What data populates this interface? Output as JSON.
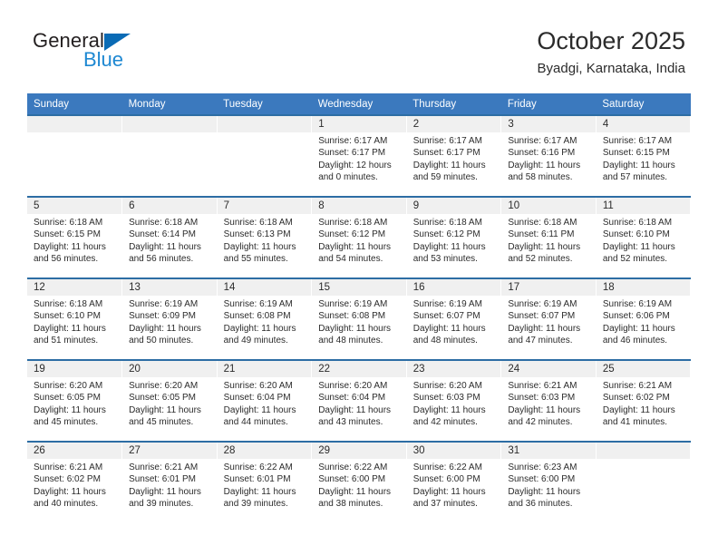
{
  "brand": {
    "name_top": "General",
    "name_bottom": "Blue",
    "triangle_icon": "triangle-icon",
    "accent_blue": "#1e88d2",
    "dark_blue": "#0a6bb5"
  },
  "header": {
    "title": "October 2025",
    "subtitle": "Byadgi, Karnataka, India"
  },
  "theme": {
    "header_row_bg": "#3b79be",
    "row_divider": "#2d6da4",
    "daynum_band_bg": "#f0f0f0",
    "text": "#2b2b2b"
  },
  "weekdays": [
    "Sunday",
    "Monday",
    "Tuesday",
    "Wednesday",
    "Thursday",
    "Friday",
    "Saturday"
  ],
  "weeks": [
    [
      {
        "day": "",
        "sunrise": "",
        "sunset": "",
        "daylight1": "",
        "daylight2": "",
        "empty": true
      },
      {
        "day": "",
        "sunrise": "",
        "sunset": "",
        "daylight1": "",
        "daylight2": "",
        "empty": true
      },
      {
        "day": "",
        "sunrise": "",
        "sunset": "",
        "daylight1": "",
        "daylight2": "",
        "empty": true
      },
      {
        "day": "1",
        "sunrise": "Sunrise: 6:17 AM",
        "sunset": "Sunset: 6:17 PM",
        "daylight1": "Daylight: 12 hours",
        "daylight2": "and 0 minutes."
      },
      {
        "day": "2",
        "sunrise": "Sunrise: 6:17 AM",
        "sunset": "Sunset: 6:17 PM",
        "daylight1": "Daylight: 11 hours",
        "daylight2": "and 59 minutes."
      },
      {
        "day": "3",
        "sunrise": "Sunrise: 6:17 AM",
        "sunset": "Sunset: 6:16 PM",
        "daylight1": "Daylight: 11 hours",
        "daylight2": "and 58 minutes."
      },
      {
        "day": "4",
        "sunrise": "Sunrise: 6:17 AM",
        "sunset": "Sunset: 6:15 PM",
        "daylight1": "Daylight: 11 hours",
        "daylight2": "and 57 minutes."
      }
    ],
    [
      {
        "day": "5",
        "sunrise": "Sunrise: 6:18 AM",
        "sunset": "Sunset: 6:15 PM",
        "daylight1": "Daylight: 11 hours",
        "daylight2": "and 56 minutes."
      },
      {
        "day": "6",
        "sunrise": "Sunrise: 6:18 AM",
        "sunset": "Sunset: 6:14 PM",
        "daylight1": "Daylight: 11 hours",
        "daylight2": "and 56 minutes."
      },
      {
        "day": "7",
        "sunrise": "Sunrise: 6:18 AM",
        "sunset": "Sunset: 6:13 PM",
        "daylight1": "Daylight: 11 hours",
        "daylight2": "and 55 minutes."
      },
      {
        "day": "8",
        "sunrise": "Sunrise: 6:18 AM",
        "sunset": "Sunset: 6:12 PM",
        "daylight1": "Daylight: 11 hours",
        "daylight2": "and 54 minutes."
      },
      {
        "day": "9",
        "sunrise": "Sunrise: 6:18 AM",
        "sunset": "Sunset: 6:12 PM",
        "daylight1": "Daylight: 11 hours",
        "daylight2": "and 53 minutes."
      },
      {
        "day": "10",
        "sunrise": "Sunrise: 6:18 AM",
        "sunset": "Sunset: 6:11 PM",
        "daylight1": "Daylight: 11 hours",
        "daylight2": "and 52 minutes."
      },
      {
        "day": "11",
        "sunrise": "Sunrise: 6:18 AM",
        "sunset": "Sunset: 6:10 PM",
        "daylight1": "Daylight: 11 hours",
        "daylight2": "and 52 minutes."
      }
    ],
    [
      {
        "day": "12",
        "sunrise": "Sunrise: 6:18 AM",
        "sunset": "Sunset: 6:10 PM",
        "daylight1": "Daylight: 11 hours",
        "daylight2": "and 51 minutes."
      },
      {
        "day": "13",
        "sunrise": "Sunrise: 6:19 AM",
        "sunset": "Sunset: 6:09 PM",
        "daylight1": "Daylight: 11 hours",
        "daylight2": "and 50 minutes."
      },
      {
        "day": "14",
        "sunrise": "Sunrise: 6:19 AM",
        "sunset": "Sunset: 6:08 PM",
        "daylight1": "Daylight: 11 hours",
        "daylight2": "and 49 minutes."
      },
      {
        "day": "15",
        "sunrise": "Sunrise: 6:19 AM",
        "sunset": "Sunset: 6:08 PM",
        "daylight1": "Daylight: 11 hours",
        "daylight2": "and 48 minutes."
      },
      {
        "day": "16",
        "sunrise": "Sunrise: 6:19 AM",
        "sunset": "Sunset: 6:07 PM",
        "daylight1": "Daylight: 11 hours",
        "daylight2": "and 48 minutes."
      },
      {
        "day": "17",
        "sunrise": "Sunrise: 6:19 AM",
        "sunset": "Sunset: 6:07 PM",
        "daylight1": "Daylight: 11 hours",
        "daylight2": "and 47 minutes."
      },
      {
        "day": "18",
        "sunrise": "Sunrise: 6:19 AM",
        "sunset": "Sunset: 6:06 PM",
        "daylight1": "Daylight: 11 hours",
        "daylight2": "and 46 minutes."
      }
    ],
    [
      {
        "day": "19",
        "sunrise": "Sunrise: 6:20 AM",
        "sunset": "Sunset: 6:05 PM",
        "daylight1": "Daylight: 11 hours",
        "daylight2": "and 45 minutes."
      },
      {
        "day": "20",
        "sunrise": "Sunrise: 6:20 AM",
        "sunset": "Sunset: 6:05 PM",
        "daylight1": "Daylight: 11 hours",
        "daylight2": "and 45 minutes."
      },
      {
        "day": "21",
        "sunrise": "Sunrise: 6:20 AM",
        "sunset": "Sunset: 6:04 PM",
        "daylight1": "Daylight: 11 hours",
        "daylight2": "and 44 minutes."
      },
      {
        "day": "22",
        "sunrise": "Sunrise: 6:20 AM",
        "sunset": "Sunset: 6:04 PM",
        "daylight1": "Daylight: 11 hours",
        "daylight2": "and 43 minutes."
      },
      {
        "day": "23",
        "sunrise": "Sunrise: 6:20 AM",
        "sunset": "Sunset: 6:03 PM",
        "daylight1": "Daylight: 11 hours",
        "daylight2": "and 42 minutes."
      },
      {
        "day": "24",
        "sunrise": "Sunrise: 6:21 AM",
        "sunset": "Sunset: 6:03 PM",
        "daylight1": "Daylight: 11 hours",
        "daylight2": "and 42 minutes."
      },
      {
        "day": "25",
        "sunrise": "Sunrise: 6:21 AM",
        "sunset": "Sunset: 6:02 PM",
        "daylight1": "Daylight: 11 hours",
        "daylight2": "and 41 minutes."
      }
    ],
    [
      {
        "day": "26",
        "sunrise": "Sunrise: 6:21 AM",
        "sunset": "Sunset: 6:02 PM",
        "daylight1": "Daylight: 11 hours",
        "daylight2": "and 40 minutes."
      },
      {
        "day": "27",
        "sunrise": "Sunrise: 6:21 AM",
        "sunset": "Sunset: 6:01 PM",
        "daylight1": "Daylight: 11 hours",
        "daylight2": "and 39 minutes."
      },
      {
        "day": "28",
        "sunrise": "Sunrise: 6:22 AM",
        "sunset": "Sunset: 6:01 PM",
        "daylight1": "Daylight: 11 hours",
        "daylight2": "and 39 minutes."
      },
      {
        "day": "29",
        "sunrise": "Sunrise: 6:22 AM",
        "sunset": "Sunset: 6:00 PM",
        "daylight1": "Daylight: 11 hours",
        "daylight2": "and 38 minutes."
      },
      {
        "day": "30",
        "sunrise": "Sunrise: 6:22 AM",
        "sunset": "Sunset: 6:00 PM",
        "daylight1": "Daylight: 11 hours",
        "daylight2": "and 37 minutes."
      },
      {
        "day": "31",
        "sunrise": "Sunrise: 6:23 AM",
        "sunset": "Sunset: 6:00 PM",
        "daylight1": "Daylight: 11 hours",
        "daylight2": "and 36 minutes."
      },
      {
        "day": "",
        "sunrise": "",
        "sunset": "",
        "daylight1": "",
        "daylight2": "",
        "empty": true
      }
    ]
  ]
}
